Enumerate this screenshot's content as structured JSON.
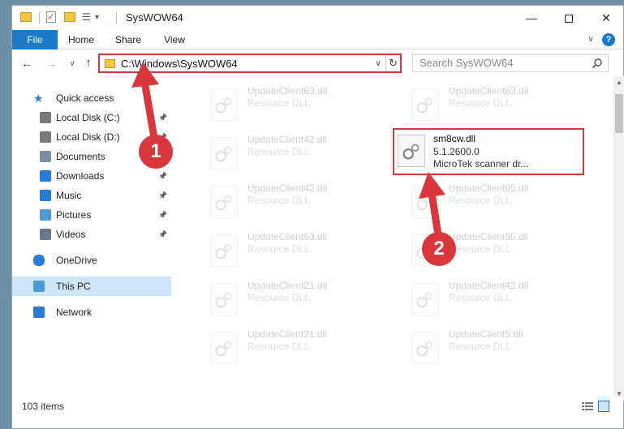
{
  "window": {
    "title": "SysWOW64",
    "minimize": "—",
    "close": "✕"
  },
  "ribbon": {
    "tabs": [
      "File",
      "Home",
      "Share",
      "View"
    ],
    "help": "?"
  },
  "nav": {
    "back": "←",
    "forward": "→",
    "recent": "∨",
    "up": "↑"
  },
  "address": {
    "path": "C:\\Windows\\SysWOW64",
    "dropdown": "∨",
    "refresh": "↻"
  },
  "search": {
    "placeholder": "Search SysWOW64"
  },
  "sidebar": {
    "items": [
      {
        "label": "Quick access",
        "icon": "star-icon"
      },
      {
        "label": "Local Disk (C:)",
        "icon": "drive-icon",
        "pinned": true
      },
      {
        "label": "Local Disk (D:)",
        "icon": "drive-icon",
        "pinned": true
      },
      {
        "label": "Documents",
        "icon": "documents-icon",
        "pinned": true
      },
      {
        "label": "Downloads",
        "icon": "download-icon",
        "pinned": true
      },
      {
        "label": "Music",
        "icon": "music-icon",
        "pinned": true
      },
      {
        "label": "Pictures",
        "icon": "pictures-icon",
        "pinned": true
      },
      {
        "label": "Videos",
        "icon": "video-icon",
        "pinned": true
      },
      {
        "label": "OneDrive",
        "icon": "cloud-icon"
      },
      {
        "label": "This PC",
        "icon": "computer-icon",
        "selected": true
      },
      {
        "label": "Network",
        "icon": "network-icon"
      }
    ]
  },
  "files": [
    {
      "name": "UpdateClient63.dll",
      "type": "Resource DLL",
      "faded": true
    },
    {
      "name": "UpdateClient63.dll",
      "type": "Resource DLL",
      "faded": true
    },
    {
      "name": "UpdateClient42.dll",
      "type": "Resource DLL",
      "faded": true
    },
    {
      "name": "sm8cw.dll",
      "type": "5.1.2600.0",
      "desc": "MicroTek scanner dr...",
      "highlighted": true
    },
    {
      "name": "UpdateClient42.dll",
      "type": "Resource DLL",
      "faded": true
    },
    {
      "name": "UpdateClient65.dll",
      "type": "Resource DLL",
      "faded": true
    },
    {
      "name": "UpdateClient63.dll",
      "type": "Resource DLL",
      "faded": true
    },
    {
      "name": "UpdateClient65.dll",
      "type": "Resource DLL",
      "faded": true
    },
    {
      "name": "UpdateClient21.dll",
      "type": "Resource DLL",
      "faded": true
    },
    {
      "name": "UpdateClient42.dll",
      "type": "Resource DLL",
      "faded": true
    },
    {
      "name": "UpdateClient21.dll",
      "type": "Resource DLL",
      "faded": true
    },
    {
      "name": "UpdateClient5.dll",
      "type": "Resource DLL",
      "faded": true
    }
  ],
  "status": {
    "count": "103 items"
  },
  "annotations": {
    "step1": "1",
    "step2": "2",
    "color": "#d9363e"
  },
  "colors": {
    "accent": "#1979ca",
    "highlight": "#d9363e",
    "selected_bg": "#cde6f7"
  }
}
